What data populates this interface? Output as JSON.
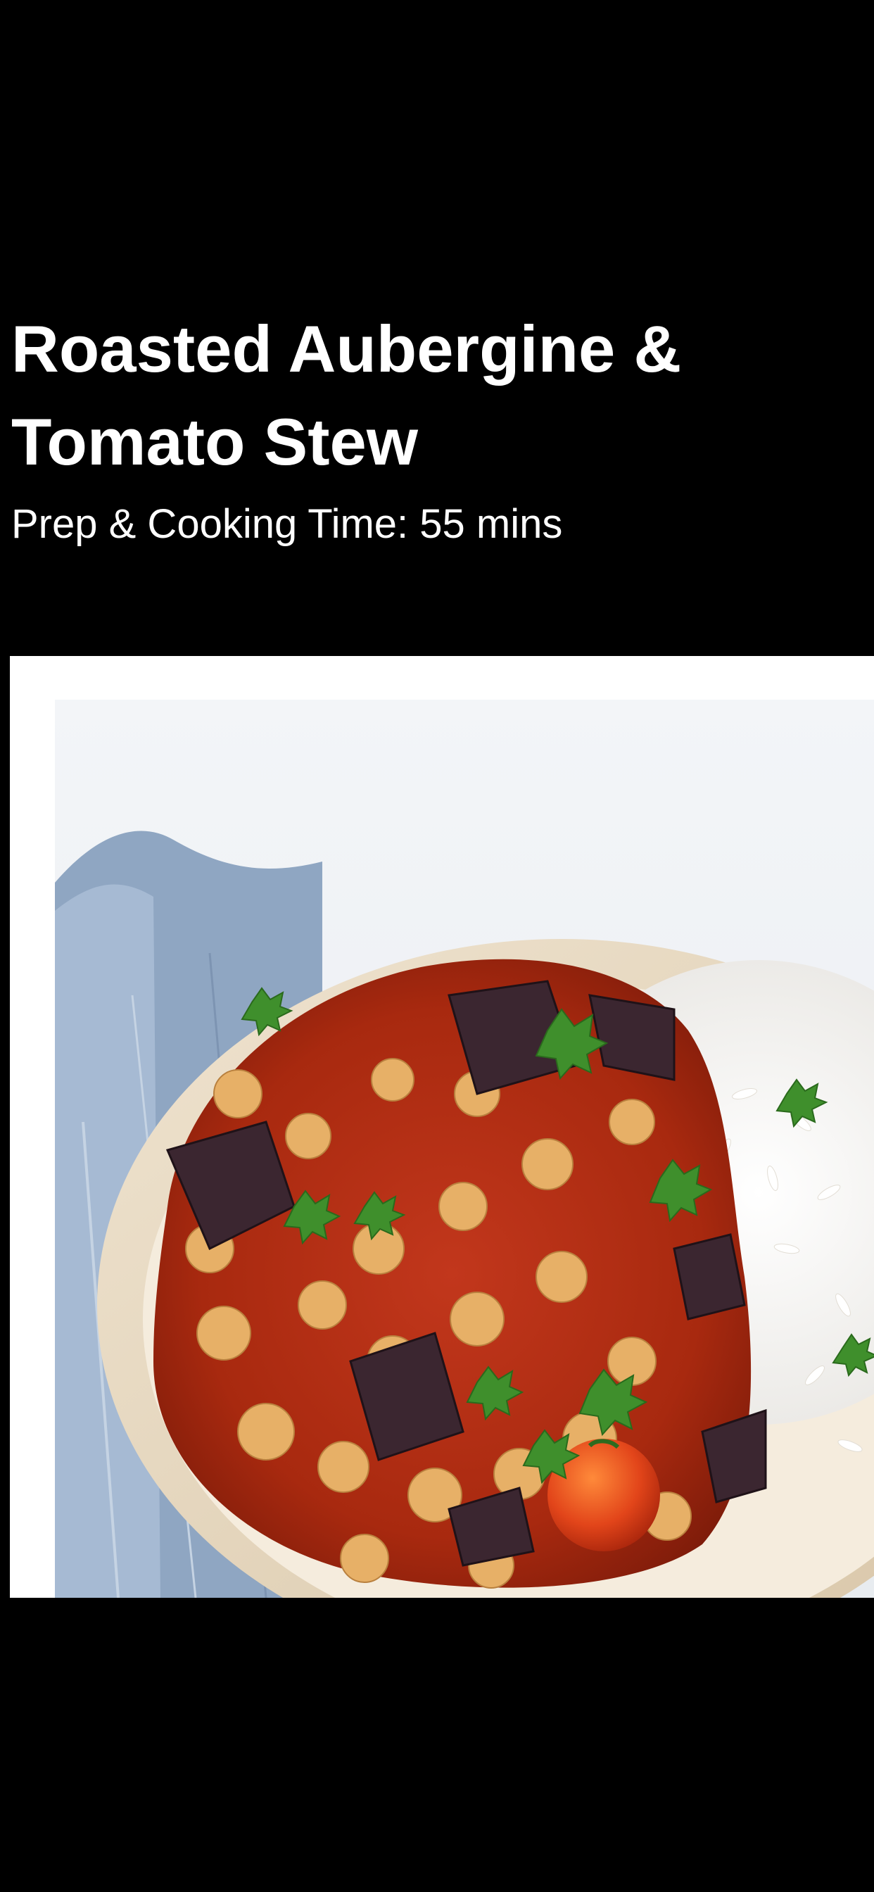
{
  "recipe": {
    "title": "Roasted Aubergine & Tomato Stew",
    "prep_label": "Prep & Cooking Time: 55 mins"
  },
  "image": {
    "subject": "recipe-photo"
  },
  "colors": {
    "background": "#000000",
    "text": "#ffffff",
    "card": "#ffffff"
  }
}
